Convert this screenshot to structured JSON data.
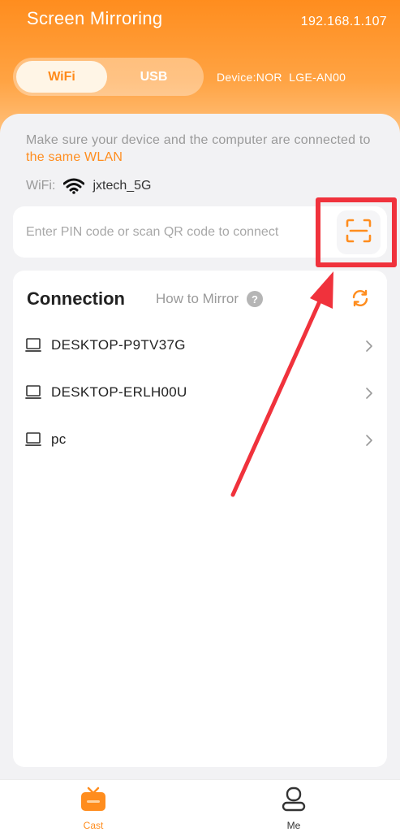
{
  "header": {
    "title": "Screen Mirroring",
    "ip_address": "192.168.1.107",
    "toggle": {
      "wifi_label": "WiFi",
      "usb_label": "USB",
      "selected": "WiFi"
    },
    "device_label": "Device:NOR  LGE-AN00"
  },
  "notice": {
    "text_before": "Make sure your device and the computer are connected to ",
    "highlight": "the same WLAN"
  },
  "wifi": {
    "label": "WiFi:",
    "icon": "wifi-icon",
    "network_name": "jxtech_5G"
  },
  "pin": {
    "placeholder": "Enter PIN code or scan QR code to connect",
    "value": "",
    "scan_icon": "scan-qr-icon"
  },
  "connection": {
    "title": "Connection",
    "how_to_label": "How to Mirror",
    "help_icon": "?",
    "refresh_icon": "refresh-icon",
    "devices": [
      {
        "name": "DESKTOP-P9TV37G",
        "icon": "pc-icon"
      },
      {
        "name": "DESKTOP-ERLH00U",
        "icon": "pc-icon"
      },
      {
        "name": "pc",
        "icon": "pc-icon"
      }
    ]
  },
  "bottom_nav": {
    "items": [
      {
        "label": "Cast",
        "icon": "tv-cast-icon",
        "active": true
      },
      {
        "label": "Me",
        "icon": "person-icon",
        "active": false
      }
    ]
  },
  "colors": {
    "accent": "#ff8d1e",
    "highlight_border": "#f0323c"
  }
}
